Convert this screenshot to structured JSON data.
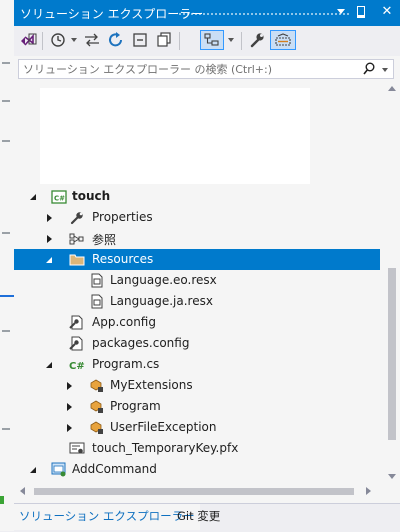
{
  "window": {
    "title": "ソリューション エクスプローラー"
  },
  "toolbar": {
    "buttons": [
      {
        "name": "switch-views",
        "icon": "vs-switch-views-icon"
      },
      {
        "name": "history",
        "icon": "clock-history-icon"
      },
      {
        "name": "sync-with-active-document",
        "icon": "two-way-arrow-icon"
      },
      {
        "name": "refresh",
        "icon": "refresh-icon"
      },
      {
        "name": "collapse-all",
        "icon": "collapse-all-icon"
      },
      {
        "name": "show-all-files",
        "icon": "show-all-files-icon"
      },
      {
        "name": "pending-changes-filter",
        "icon": "filter-tree-icon"
      },
      {
        "name": "properties",
        "icon": "wrench-icon"
      },
      {
        "name": "preview-selected-items",
        "icon": "preview-icon"
      }
    ]
  },
  "search": {
    "placeholder": "ソリューション エクスプローラー の検索 (Ctrl+:)",
    "value": ""
  },
  "tree": {
    "project": {
      "label": "touch",
      "icon": "csharp-project-icon"
    },
    "items": [
      {
        "label": "Properties",
        "icon": "wrench-icon"
      },
      {
        "label": "参照",
        "icon": "references-icon"
      },
      {
        "label": "Resources",
        "icon": "folder-icon",
        "selected": true
      },
      {
        "label": "Language.eo.resx",
        "icon": "resx-file-icon"
      },
      {
        "label": "Language.ja.resx",
        "icon": "resx-file-icon"
      },
      {
        "label": "App.config",
        "icon": "config-file-icon"
      },
      {
        "label": "packages.config",
        "icon": "config-file-icon"
      },
      {
        "label": "Program.cs",
        "icon": "csharp-file-icon"
      },
      {
        "label": "MyExtensions",
        "icon": "class-icon"
      },
      {
        "label": "Program",
        "icon": "class-icon"
      },
      {
        "label": "UserFileException",
        "icon": "class-icon"
      },
      {
        "label": "touch_TemporaryKey.pfx",
        "icon": "certificate-icon"
      },
      {
        "label": "AddCommand",
        "icon": "csharp-project-icon"
      }
    ]
  },
  "tabs": [
    {
      "label": "ソリューション エクスプローラー",
      "active": true
    },
    {
      "label": "Git 変更",
      "active": false
    }
  ],
  "colors": {
    "accent": "#007acc",
    "selection": "#007acc",
    "panel_background": "#f5f5f5",
    "toolbar_background": "#eeeef2",
    "active_tab_text": "#0e70c0"
  }
}
